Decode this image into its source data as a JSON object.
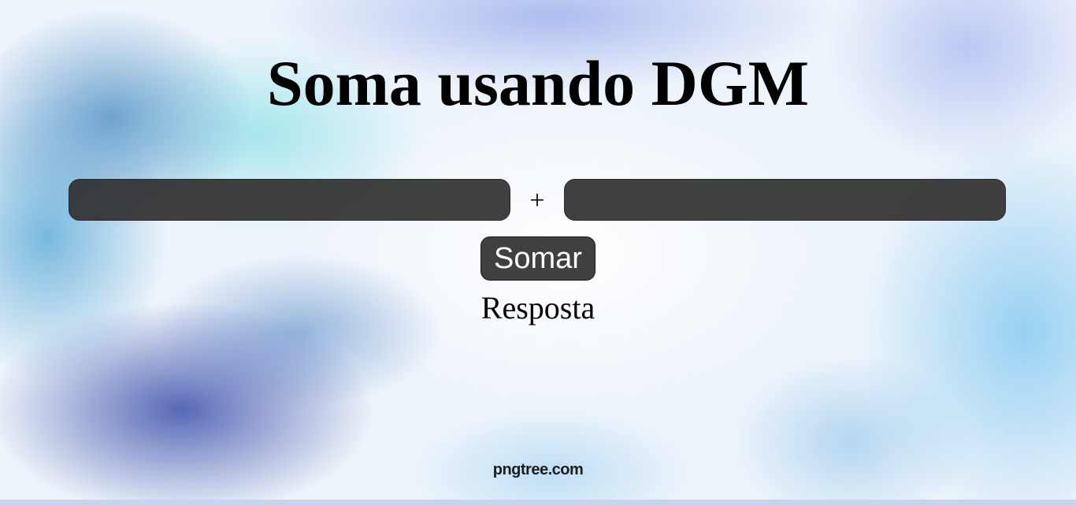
{
  "page": {
    "title": "Soma usando DGM"
  },
  "form": {
    "first_value": "",
    "second_value": "",
    "operator": "+",
    "submit_label": "Somar"
  },
  "result": {
    "text": "Resposta"
  },
  "watermark": {
    "text": "pngtree.com"
  },
  "colors": {
    "input_background": "#303030",
    "button_background": "#404040",
    "text": "#000000"
  }
}
